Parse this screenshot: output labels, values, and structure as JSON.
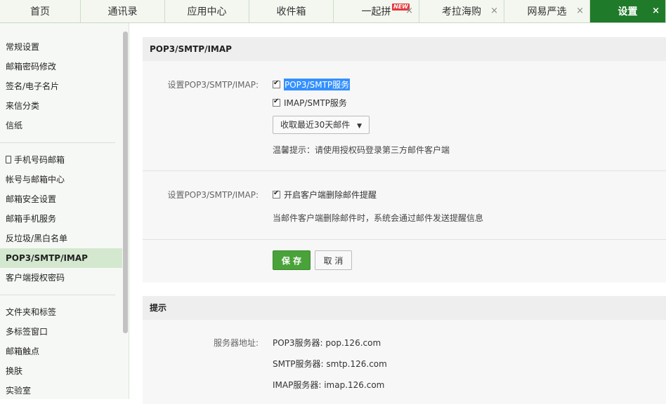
{
  "tabs": [
    {
      "label": "首页",
      "width": 115
    },
    {
      "label": "通讯录",
      "width": 120
    },
    {
      "label": "应用中心",
      "width": 120
    },
    {
      "label": "收件箱",
      "width": 120
    },
    {
      "label": "一起拼",
      "badge": "NEW",
      "closable": true,
      "width": 122
    },
    {
      "label": "考拉海购",
      "closable": true,
      "width": 121
    },
    {
      "label": "网易严选",
      "closable": true,
      "width": 122
    },
    {
      "label": "设置",
      "closable": true,
      "active": true,
      "width": 108
    }
  ],
  "close_glyph": "×",
  "sidebar": {
    "group1": [
      "常规设置",
      "邮箱密码修改",
      "签名/电子名片",
      "来信分类",
      "信纸"
    ],
    "group2": [
      "手机号码邮箱",
      "帐号与邮箱中心",
      "邮箱安全设置",
      "邮箱手机服务",
      "反垃圾/黑白名单",
      "POP3/SMTP/IMAP",
      "客户端授权密码"
    ],
    "group3": [
      "文件夹和标签",
      "多标签窗口",
      "邮箱触点",
      "换肤",
      "实验室"
    ],
    "active_item": "POP3/SMTP/IMAP"
  },
  "main": {
    "section_title": "POP3/SMTP/IMAP",
    "row1_label": "设置POP3/SMTP/IMAP:",
    "pop3_option": "POP3/SMTP服务",
    "imap_option": "IMAP/SMTP服务",
    "dropdown_value": "收取最近30天邮件",
    "warm_tip": "温馨提示：请使用授权码登录第三方邮件客户端",
    "row2_label": "设置POP3/SMTP/IMAP:",
    "delete_alert_option": "开启客户端删除邮件提醒",
    "delete_alert_desc": "当邮件客户端删除邮件时，系统会通过邮件发送提醒信息",
    "save_label": "保 存",
    "cancel_label": "取 消"
  },
  "tips": {
    "section_title": "提示",
    "server_label": "服务器地址:",
    "pop3_server": "POP3服务器: pop.126.com",
    "smtp_server": "SMTP服务器: smtp.126.com",
    "imap_server": "IMAP服务器: imap.126.com"
  },
  "colors": {
    "accent": "#1f7a2a",
    "save_button": "#4aa23a",
    "selection": "#3390ff"
  }
}
